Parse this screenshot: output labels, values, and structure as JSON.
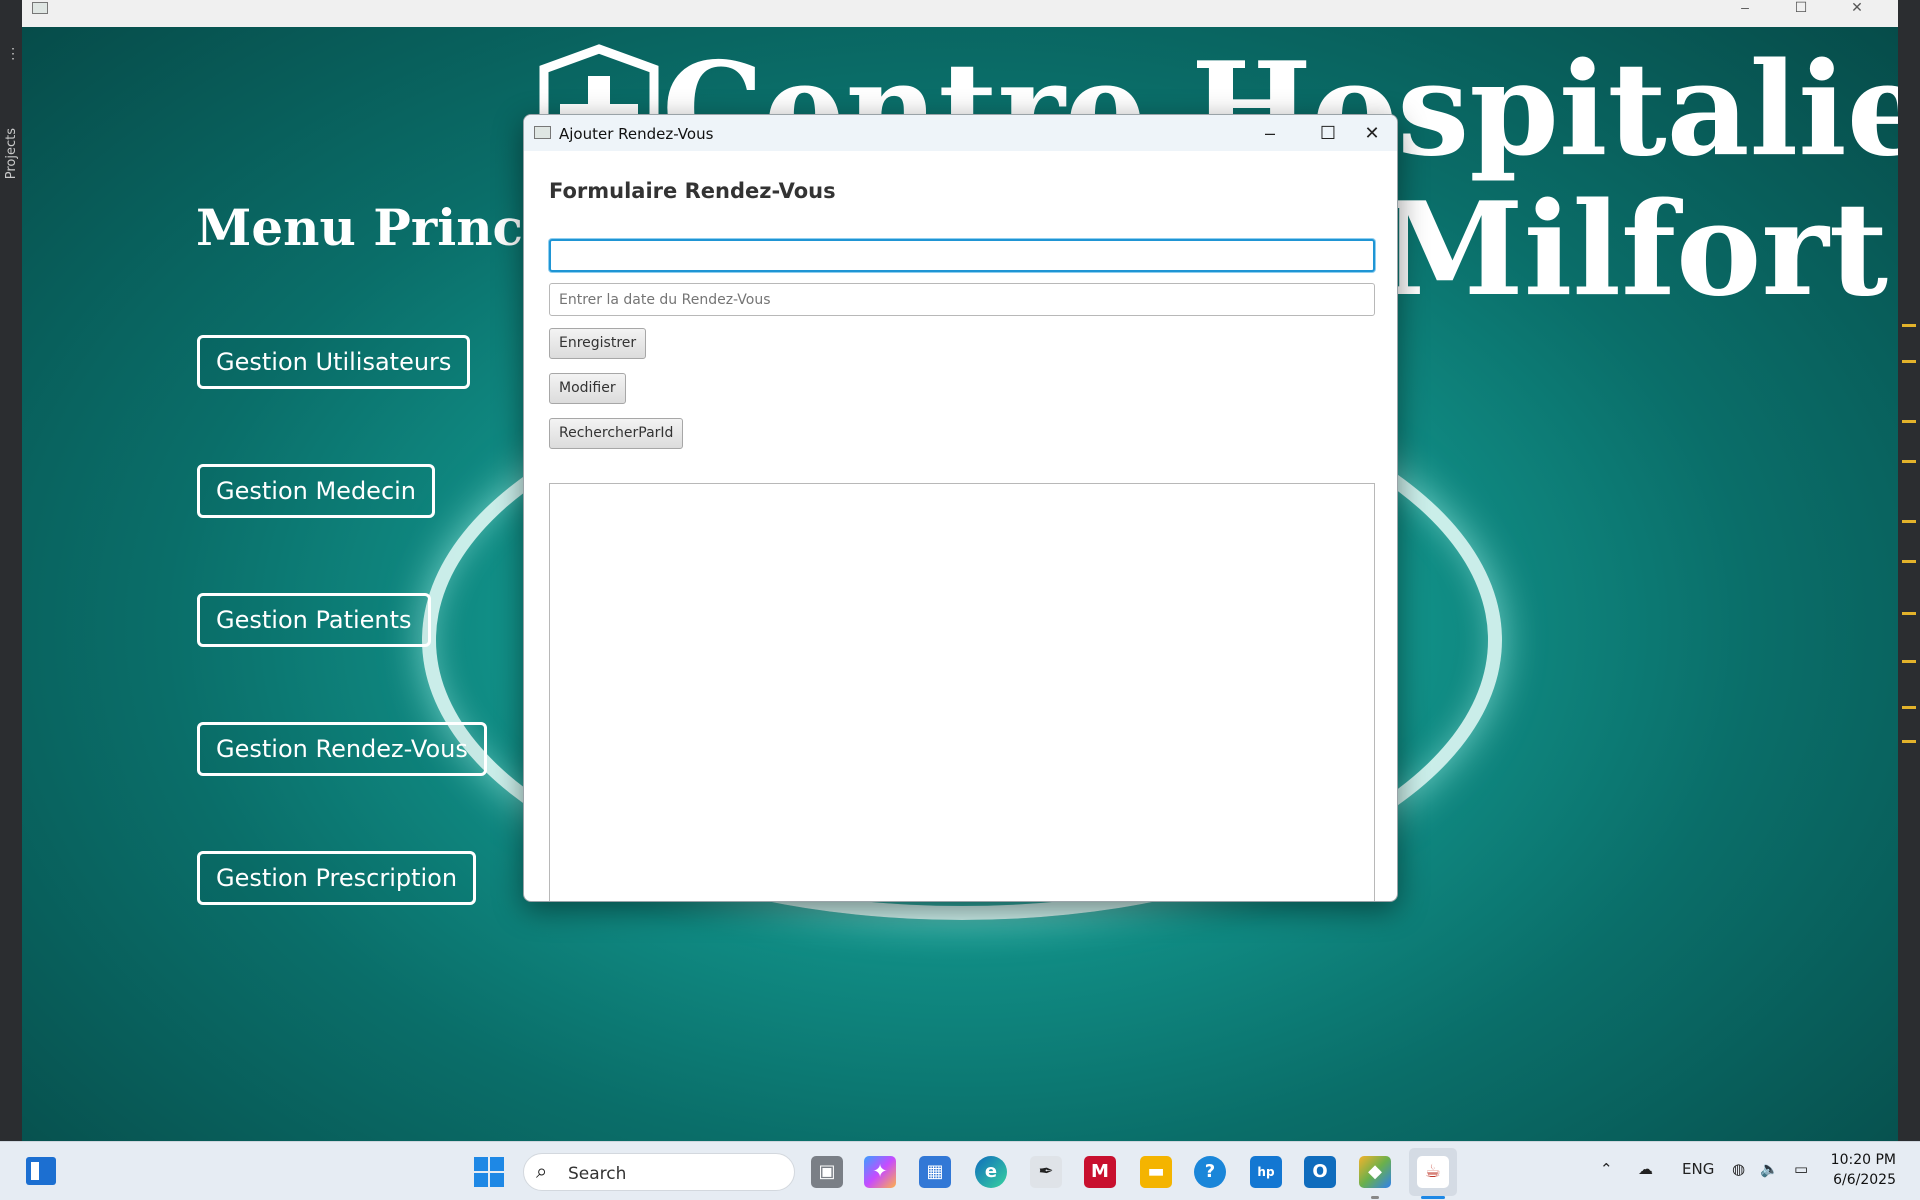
{
  "ide": {
    "projects_label": "Projects"
  },
  "background_app": {
    "hospital_title_line1": "Centre Hospitalier",
    "hospital_title_line2": "Milfort.",
    "menu_title": "Menu Principal",
    "menu_buttons": [
      "Gestion Utilisateurs",
      "Gestion Medecin",
      "Gestion Patients",
      "Gestion Rendez-Vous",
      "Gestion Prescription"
    ]
  },
  "dialog": {
    "title": "Ajouter Rendez-Vous",
    "heading": "Formulaire Rendez-Vous",
    "first_input_value": "",
    "date_placeholder": "Entrer la date du Rendez-Vous",
    "buttons": {
      "save": "Enregistrer",
      "modify": "Modifier",
      "search_by_id": "RechercherParId"
    },
    "output_text": ""
  },
  "taskbar": {
    "search_placeholder": "Search",
    "language": "ENG",
    "time": "10:20 PM",
    "date": "6/6/2025",
    "apps": [
      "task-view",
      "copilot",
      "microsoft-store",
      "edge",
      "inkscape",
      "mcafee",
      "file-explorer",
      "get-help",
      "myhp",
      "outlook",
      "netbeans",
      "java-app"
    ]
  },
  "colors": {
    "background_teal": "#12958c",
    "focus_blue": "#1f95d4",
    "start_blue": "#1e88e5"
  }
}
